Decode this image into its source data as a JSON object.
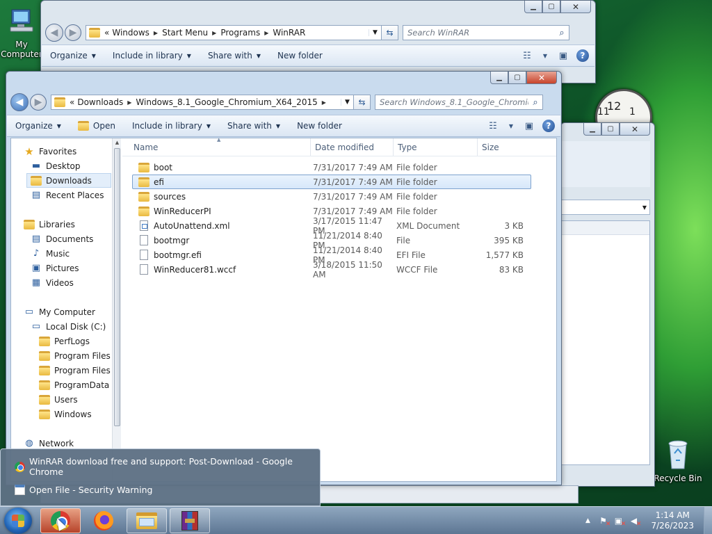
{
  "desktop": {
    "icons": [
      {
        "label": "My Computer",
        "icon": "computer-icon"
      },
      {
        "label": "Recycle Bin",
        "icon": "recycle-bin-icon"
      }
    ],
    "clock_gadget": {
      "numbers": [
        "11",
        "12",
        "1"
      ]
    }
  },
  "back_window": {
    "address": {
      "prefix": "«",
      "crumbs": [
        "Windows",
        "Start Menu",
        "Programs",
        "WinRAR"
      ]
    },
    "search_placeholder": "Search WinRAR",
    "toolbar": {
      "organize": "Organize",
      "include": "Include in library",
      "share": "Share with",
      "new_folder": "New folder"
    }
  },
  "main_window": {
    "address": {
      "prefix": "«",
      "crumbs": [
        "Downloads",
        "Windows_8.1_Google_Chromium_X64_2015"
      ]
    },
    "search_placeholder": "Search Windows_8.1_Google_Chromiu...",
    "toolbar": {
      "organize": "Organize",
      "open": "Open",
      "include": "Include in library",
      "share": "Share with",
      "new_folder": "New folder"
    },
    "nav": {
      "favorites": "Favorites",
      "favorites_items": [
        "Desktop",
        "Downloads",
        "Recent Places"
      ],
      "selected": "Downloads",
      "libraries": "Libraries",
      "libraries_items": [
        "Documents",
        "Music",
        "Pictures",
        "Videos"
      ],
      "computer": "My Computer",
      "local_disk": "Local Disk (C:)",
      "disk_items": [
        "PerfLogs",
        "Program Files",
        "Program Files (",
        "ProgramData",
        "Users",
        "Windows"
      ],
      "network": "Network"
    },
    "columns": {
      "name": "Name",
      "date": "Date modified",
      "type": "Type",
      "size": "Size"
    },
    "files": [
      {
        "name": "boot",
        "date": "7/31/2017 7:49 AM",
        "type": "File folder",
        "size": "",
        "kind": "folder"
      },
      {
        "name": "efi",
        "date": "7/31/2017 7:49 AM",
        "type": "File folder",
        "size": "",
        "kind": "folder",
        "selected": true
      },
      {
        "name": "sources",
        "date": "7/31/2017 7:49 AM",
        "type": "File folder",
        "size": "",
        "kind": "folder"
      },
      {
        "name": "WinReducerPI",
        "date": "7/31/2017 7:49 AM",
        "type": "File folder",
        "size": "",
        "kind": "folder"
      },
      {
        "name": "AutoUnattend.xml",
        "date": "3/17/2015 11:47 PM",
        "type": "XML Document",
        "size": "3 KB",
        "kind": "xml"
      },
      {
        "name": "bootmgr",
        "date": "11/21/2014 8:40 PM",
        "type": "File",
        "size": "395 KB",
        "kind": "file"
      },
      {
        "name": "bootmgr.efi",
        "date": "11/21/2014 8:40 PM",
        "type": "EFI File",
        "size": "1,577 KB",
        "kind": "file"
      },
      {
        "name": "WinReducer81.wccf",
        "date": "3/18/2015 11:50 AM",
        "type": "WCCF File",
        "size": "83 KB",
        "kind": "file"
      }
    ]
  },
  "popup": {
    "items": [
      {
        "label": "WinRAR download free and support: Post-Download - Google Chrome",
        "icon": "chrome-icon"
      },
      {
        "label": "Open File - Security Warning",
        "icon": "dialog-icon"
      }
    ]
  },
  "taskbar": {
    "apps": [
      "chrome",
      "firefox",
      "explorer",
      "winrar"
    ],
    "active_app": "chrome",
    "clock": {
      "time": "1:14 AM",
      "date": "7/26/2023"
    }
  },
  "colors": {
    "selection": "#d7e7fa",
    "selection_border": "#7da2ce",
    "taskbar": "#6f87a3",
    "popup": "#5e7084"
  }
}
